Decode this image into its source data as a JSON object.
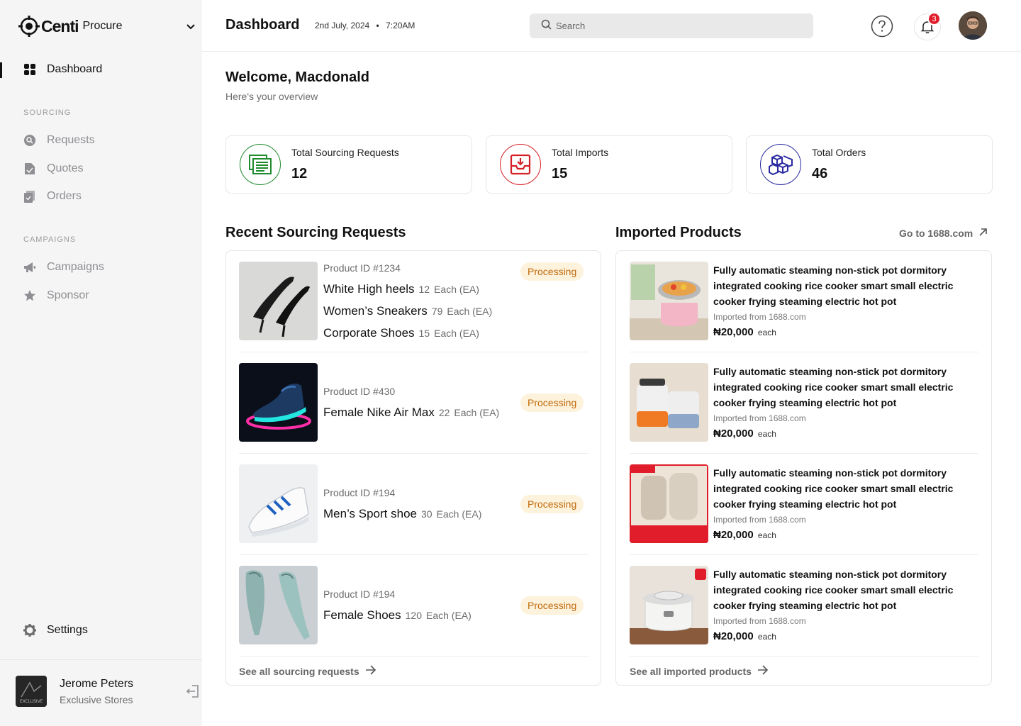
{
  "brand": {
    "name": "Centi",
    "product": "Procure"
  },
  "sidebar": {
    "dashboard": "Dashboard",
    "sections": {
      "sourcing": "SOURCING",
      "campaigns": "CAMPAIGNS"
    },
    "items": {
      "requests": "Requests",
      "quotes": "Quotes",
      "orders": "Orders",
      "campaigns": "Campaigns",
      "sponsor": "Sponsor",
      "settings": "Settings"
    },
    "user": {
      "name": "Jerome Peters",
      "store": "Exclusive Stores"
    }
  },
  "header": {
    "title": "Dashboard",
    "date": "2nd July, 2024",
    "time": "7:20AM",
    "search_placeholder": "Search",
    "notification_count": "3"
  },
  "welcome": {
    "greeting": "Welcome, Macdonald",
    "subtitle": "Here's your overview"
  },
  "stats": [
    {
      "label": "Total Sourcing Requests",
      "value": "12",
      "color": "#1f8a2e"
    },
    {
      "label": "Total Imports",
      "value": "15",
      "color": "#d42027"
    },
    {
      "label": "Total Orders",
      "value": "46",
      "color": "#2a2aa0"
    }
  ],
  "recent": {
    "title": "Recent Sourcing Requests",
    "see_all": "See all sourcing requests",
    "rows": [
      {
        "product_id": "Product ID #1234",
        "status": "Processing",
        "lines": [
          {
            "name": "White High heels",
            "qty": "12",
            "unit": "Each (EA)"
          },
          {
            "name": "Women’s Sneakers",
            "qty": "79",
            "unit": "Each (EA)"
          },
          {
            "name": "Corporate Shoes",
            "qty": "15",
            "unit": "Each (EA)"
          }
        ]
      },
      {
        "product_id": "Product ID #430",
        "status": "Processing",
        "lines": [
          {
            "name": "Female Nike Air Max",
            "qty": "22",
            "unit": "Each (EA)"
          }
        ]
      },
      {
        "product_id": "Product ID #194",
        "status": "Processing",
        "lines": [
          {
            "name": "Men’s Sport shoe",
            "qty": "30",
            "unit": "Each (EA)"
          }
        ]
      },
      {
        "product_id": "Product ID #194",
        "status": "Processing",
        "lines": [
          {
            "name": "Female Shoes",
            "qty": "120",
            "unit": "Each (EA)"
          }
        ]
      }
    ]
  },
  "imported": {
    "title": "Imported Products",
    "external_link": "Go to 1688.com",
    "see_all": "See all imported products",
    "items": [
      {
        "title": "Fully automatic steaming non-stick pot dormitory integrated cooking rice cooker smart small electric cooker frying steaming electric hot pot",
        "source": "Imported from 1688.com",
        "price": "₦20,000",
        "unit": "each"
      },
      {
        "title": "Fully automatic steaming non-stick pot dormitory integrated cooking rice cooker smart small electric cooker frying steaming electric hot pot",
        "source": "Imported from 1688.com",
        "price": "₦20,000",
        "unit": "each"
      },
      {
        "title": "Fully automatic steaming non-stick pot dormitory integrated cooking rice cooker smart small electric cooker frying steaming electric hot pot",
        "source": "Imported from 1688.com",
        "price": "₦20,000",
        "unit": "each"
      },
      {
        "title": "Fully automatic steaming non-stick pot dormitory integrated cooking rice cooker smart small electric cooker frying steaming electric hot pot",
        "source": "Imported from 1688.com",
        "price": "₦20,000",
        "unit": "each"
      }
    ]
  }
}
